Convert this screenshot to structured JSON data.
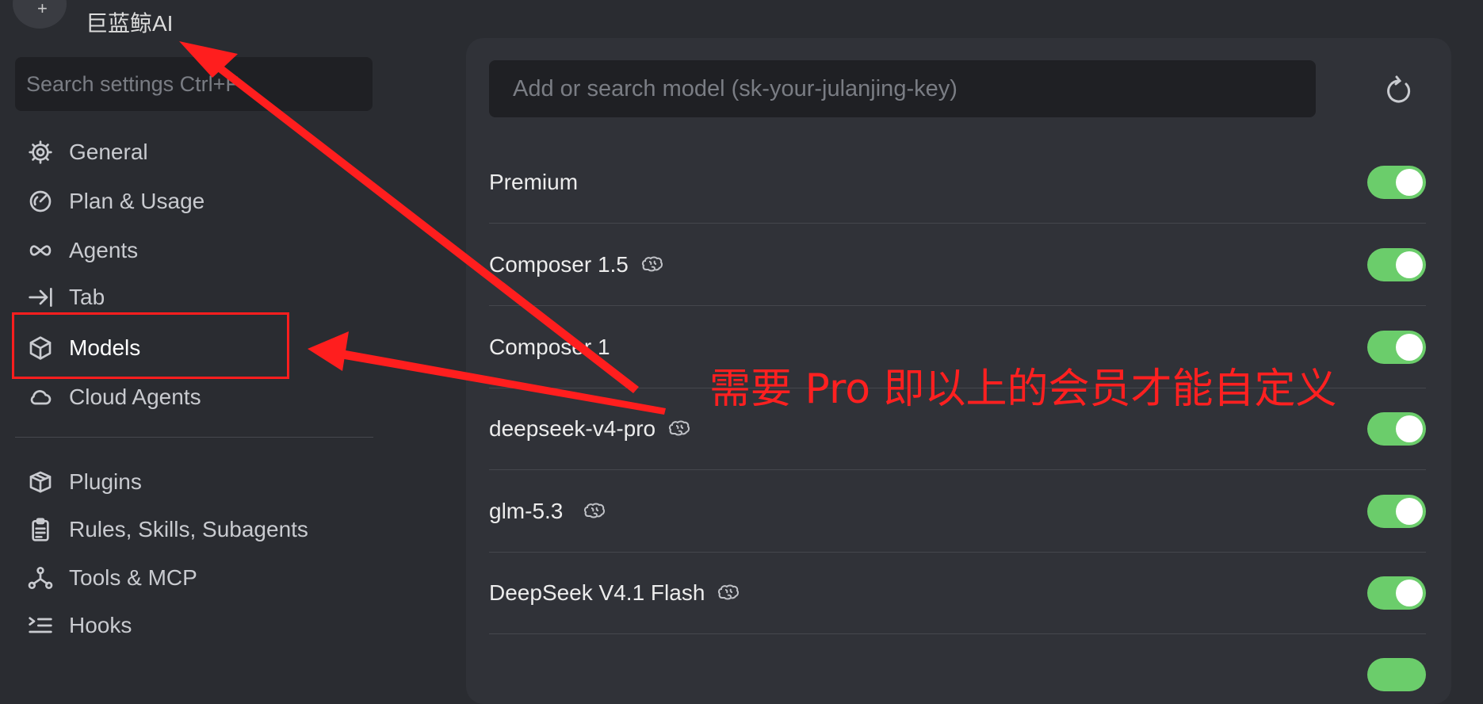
{
  "brand": {
    "name": "巨蓝鲸AI",
    "avatar_glyph": "+"
  },
  "sidebar": {
    "search_placeholder": "Search settings Ctrl+F",
    "items": [
      {
        "label": "General",
        "icon": "gear-icon"
      },
      {
        "label": "Plan & Usage",
        "icon": "gauge-icon"
      },
      {
        "label": "Agents",
        "icon": "infinity-icon"
      },
      {
        "label": "Tab",
        "icon": "arrow-right-bar-icon"
      },
      {
        "label": "Models",
        "icon": "cube-icon",
        "active": true
      },
      {
        "label": "Cloud Agents",
        "icon": "cloud-icon"
      },
      {
        "label": "Plugins",
        "icon": "box-icon"
      },
      {
        "label": "Rules, Skills, Subagents",
        "icon": "clipboard-icon"
      },
      {
        "label": "Tools & MCP",
        "icon": "nodes-icon"
      },
      {
        "label": "Hooks",
        "icon": "list-arrow-icon"
      }
    ]
  },
  "main": {
    "search_placeholder": "Add or search model (sk-your-julanjing-key)",
    "models": [
      {
        "name": "Premium",
        "thinking": false,
        "enabled": true
      },
      {
        "name": "Composer 1.5",
        "thinking": true,
        "enabled": true
      },
      {
        "name": "Composer 1",
        "thinking": false,
        "enabled": true
      },
      {
        "name": "deepseek-v4-pro",
        "thinking": true,
        "enabled": true
      },
      {
        "name": "glm-5.3",
        "thinking": true,
        "enabled": true
      },
      {
        "name": "DeepSeek V4.1 Flash",
        "thinking": true,
        "enabled": true
      }
    ]
  },
  "annotation": {
    "text": "需要 Pro 即以上的会员才能自定义",
    "color": "#ff2020"
  },
  "colors": {
    "toggle_on": "#6bcd6b",
    "background": "#2a2c31",
    "panel": "#303238"
  }
}
